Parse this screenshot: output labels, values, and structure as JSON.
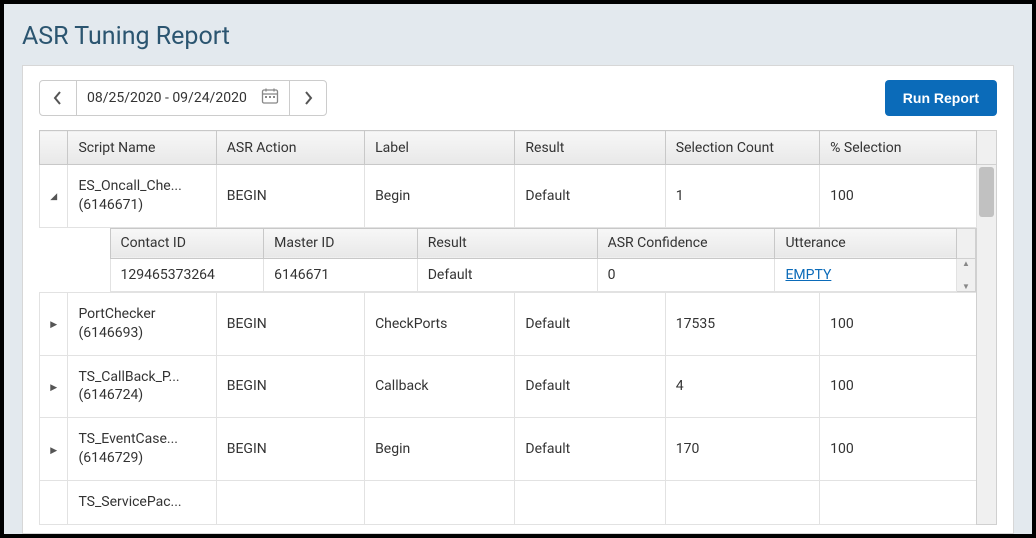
{
  "header": {
    "title": "ASR Tuning Report"
  },
  "toolbar": {
    "date_range": "08/25/2020 - 09/24/2020",
    "run_label": "Run Report"
  },
  "columns": {
    "script_name": "Script Name",
    "asr_action": "ASR Action",
    "label": "Label",
    "result": "Result",
    "selection_count": "Selection Count",
    "percent_selection": "% Selection"
  },
  "rows": [
    {
      "expanded": true,
      "script_name_line1": "ES_Oncall_Che...",
      "script_name_line2": "(6146671)",
      "asr_action": "BEGIN",
      "label": "Begin",
      "result": "Default",
      "selection_count": "1",
      "percent_selection": "100",
      "nested": {
        "columns": {
          "contact_id": "Contact ID",
          "master_id": "Master ID",
          "result": "Result",
          "asr_confidence": "ASR Confidence",
          "utterance": "Utterance"
        },
        "row": {
          "contact_id": "129465373264",
          "master_id": "6146671",
          "result": "Default",
          "asr_confidence": "0",
          "utterance": "EMPTY"
        }
      }
    },
    {
      "expanded": false,
      "script_name_line1": "PortChecker",
      "script_name_line2": "(6146693)",
      "asr_action": "BEGIN",
      "label": "CheckPorts",
      "result": "Default",
      "selection_count": "17535",
      "percent_selection": "100"
    },
    {
      "expanded": false,
      "script_name_line1": "TS_CallBack_P...",
      "script_name_line2": "(6146724)",
      "asr_action": "BEGIN",
      "label": "Callback",
      "result": "Default",
      "selection_count": "4",
      "percent_selection": "100"
    },
    {
      "expanded": false,
      "script_name_line1": "TS_EventCase...",
      "script_name_line2": "(6146729)",
      "asr_action": "BEGIN",
      "label": "Begin",
      "result": "Default",
      "selection_count": "170",
      "percent_selection": "100"
    },
    {
      "expanded": false,
      "script_name_line1": "TS_ServicePac...",
      "script_name_line2": "",
      "asr_action": "",
      "label": "",
      "result": "",
      "selection_count": "",
      "percent_selection": ""
    }
  ]
}
